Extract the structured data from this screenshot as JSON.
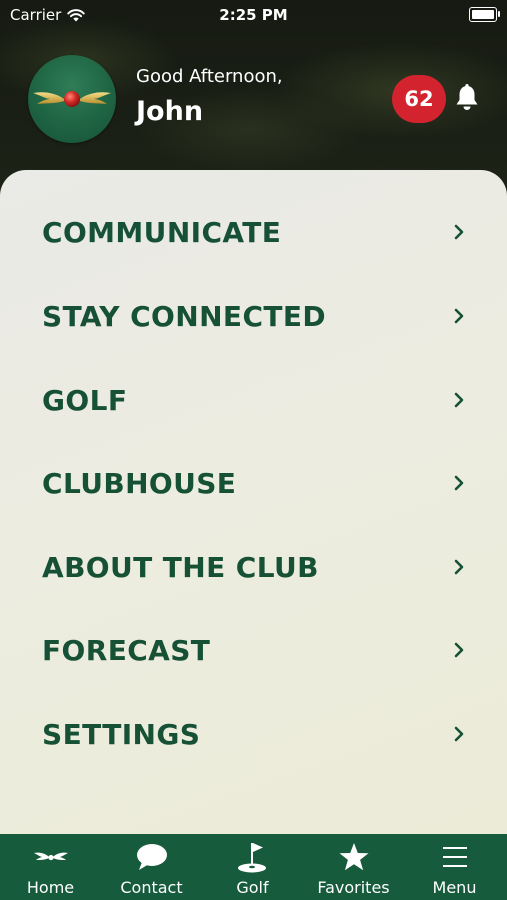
{
  "status_bar": {
    "carrier": "Carrier",
    "time": "2:25 PM"
  },
  "header": {
    "greeting": "Good Afternoon,",
    "user_name": "John",
    "notification_count": "62"
  },
  "menu": {
    "items": [
      {
        "label": "COMMUNICATE"
      },
      {
        "label": "STAY CONNECTED"
      },
      {
        "label": "GOLF"
      },
      {
        "label": "CLUBHOUSE"
      },
      {
        "label": "ABOUT THE CLUB"
      },
      {
        "label": "FORECAST"
      },
      {
        "label": "SETTINGS"
      }
    ]
  },
  "tabbar": {
    "items": [
      {
        "label": "Home",
        "icon": "wings-icon"
      },
      {
        "label": "Contact",
        "icon": "chat-bubble-icon"
      },
      {
        "label": "Golf",
        "icon": "golf-flag-icon"
      },
      {
        "label": "Favorites",
        "icon": "star-icon"
      },
      {
        "label": "Menu",
        "icon": "hamburger-icon"
      }
    ]
  },
  "colors": {
    "brand_green": "#165136",
    "tabbar_green": "#165b3b",
    "badge_red": "#d2232f"
  }
}
